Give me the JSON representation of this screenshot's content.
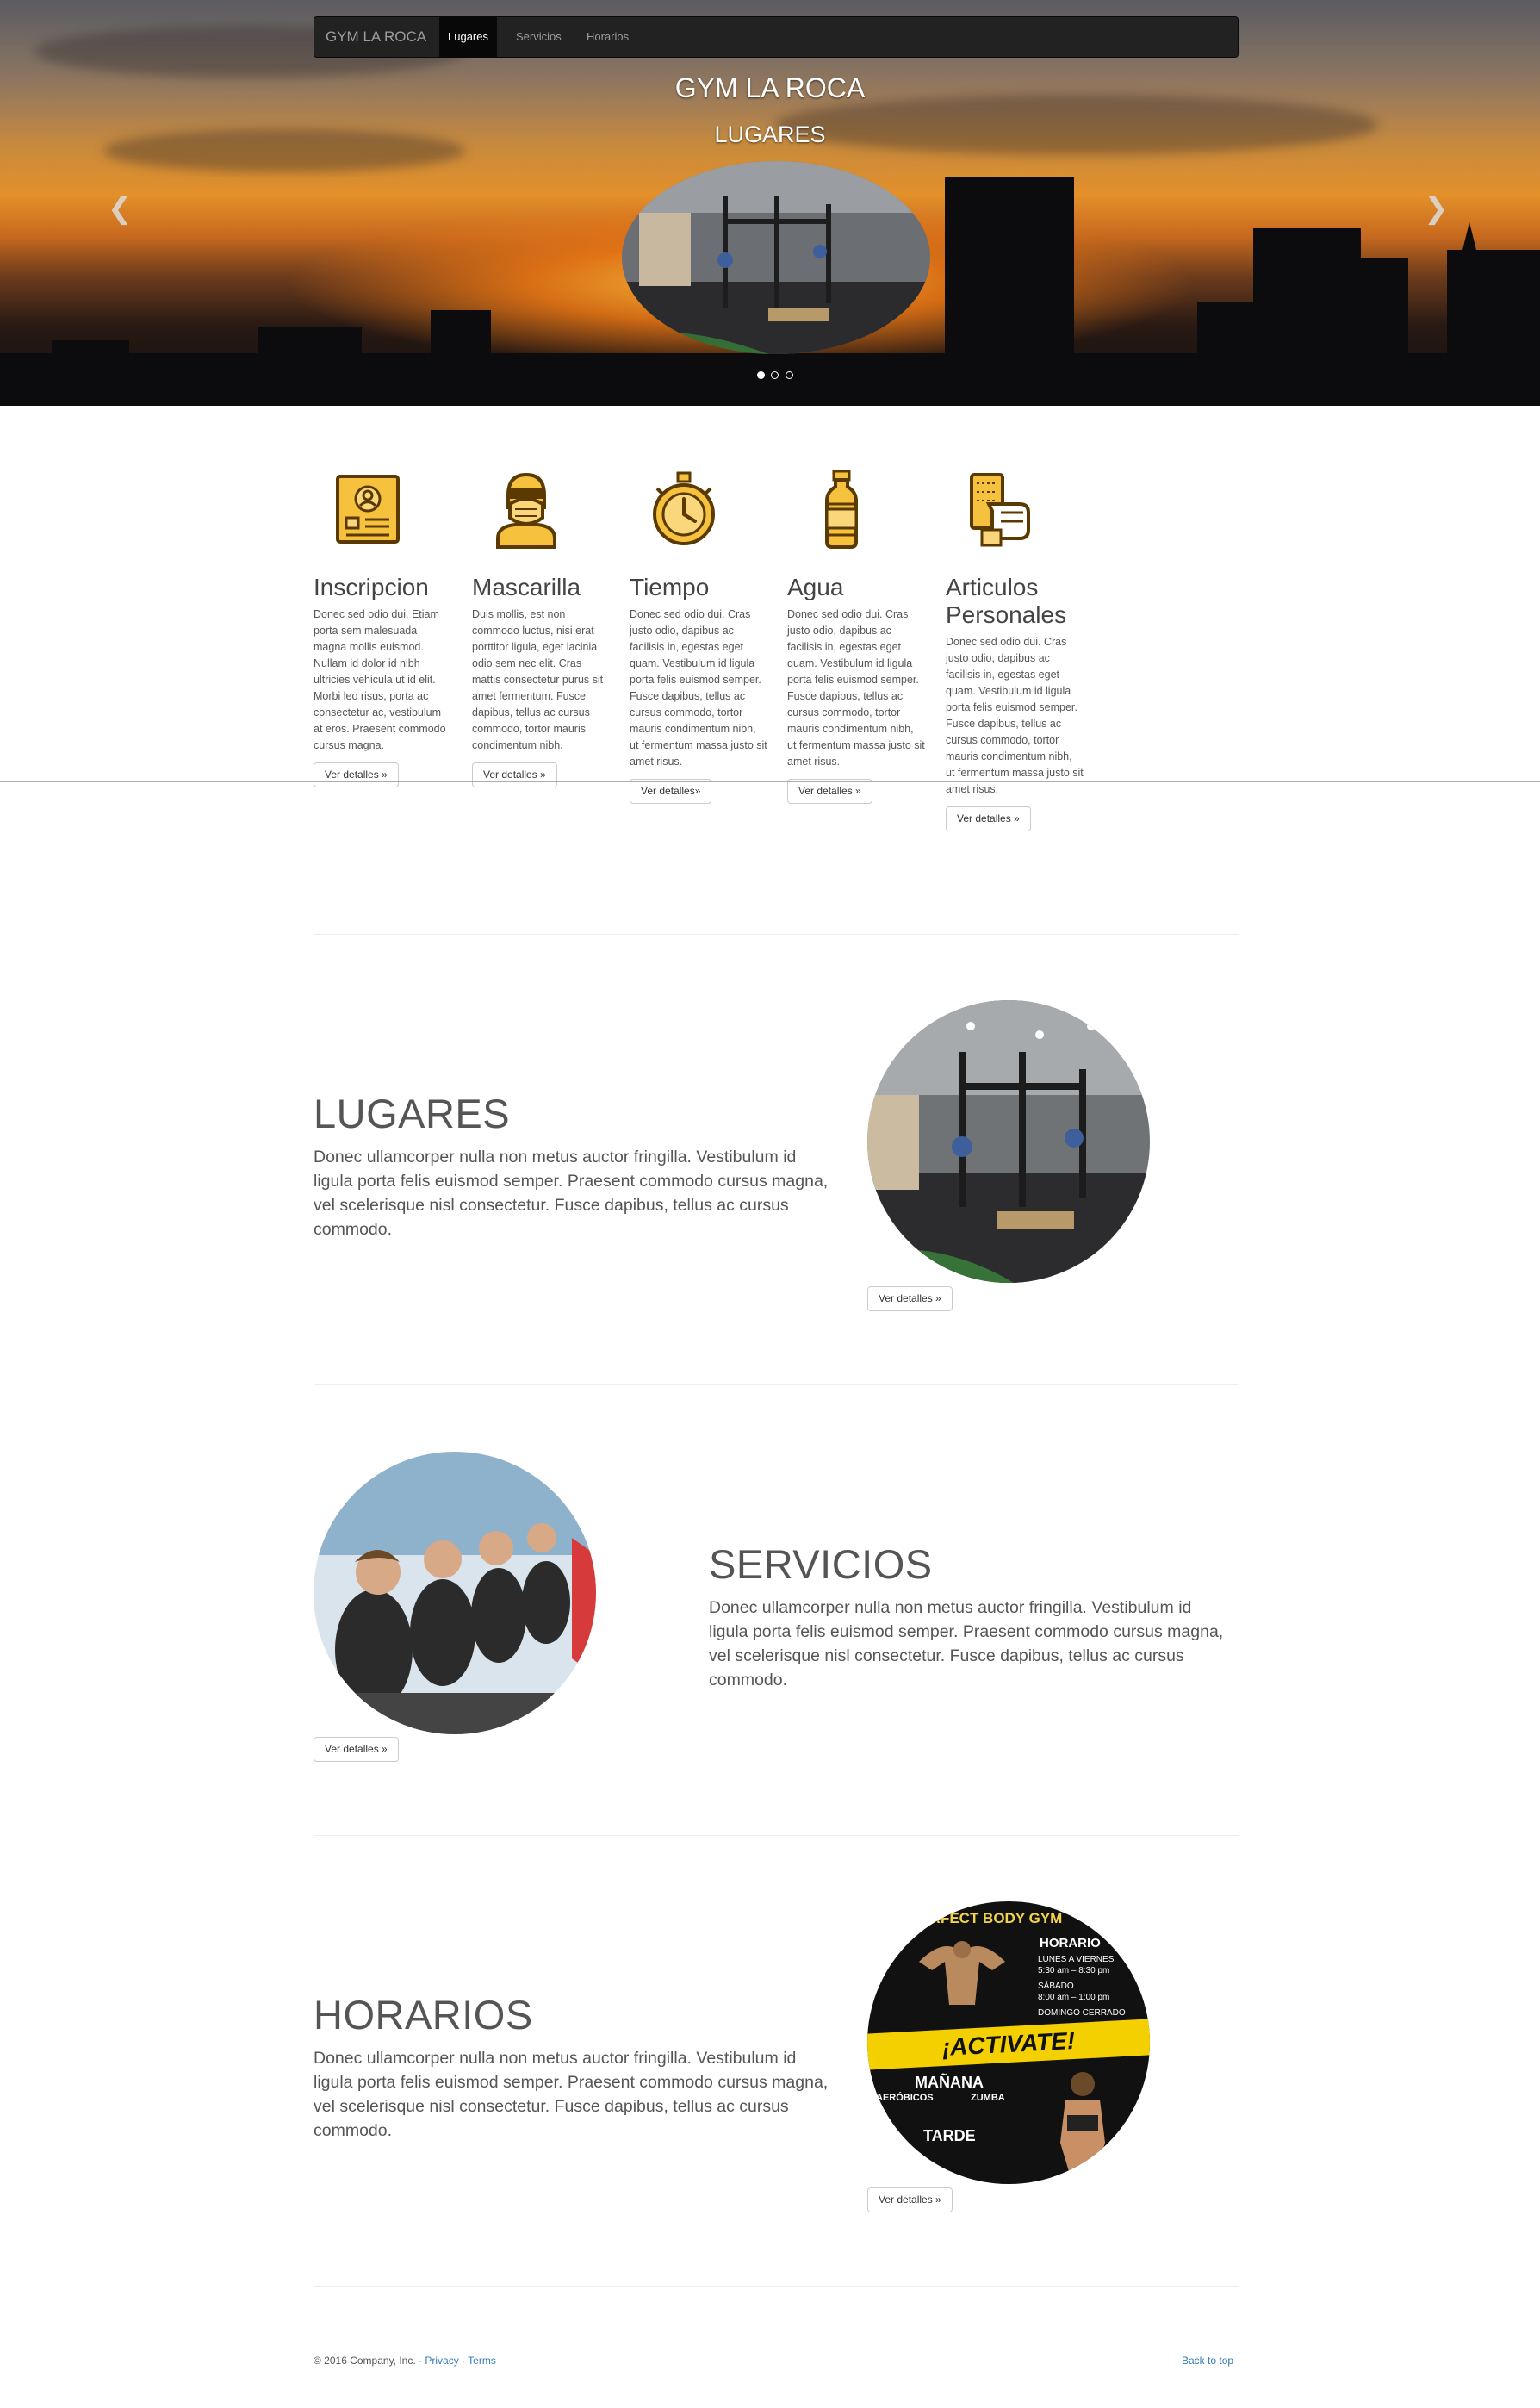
{
  "nav": {
    "brand": "GYM LA ROCA",
    "items": [
      {
        "label": "Lugares",
        "active": true
      },
      {
        "label": "Servicios",
        "active": false
      },
      {
        "label": "Horarios",
        "active": false
      }
    ]
  },
  "hero": {
    "title": "GYM LA ROCA",
    "subtitle": "LUGARES",
    "prev_icon": "chevron-left-icon",
    "next_icon": "chevron-right-icon",
    "slides_count": 3,
    "active_slide": 1
  },
  "features": [
    {
      "title": "Inscripcion",
      "icon": "id-card-icon",
      "text": "Donec sed odio dui. Etiam porta sem malesuada magna mollis euismod. Nullam id dolor id nibh ultricies vehicula ut id elit. Morbi leo risus, porta ac consectetur ac, vestibulum at eros. Praesent commodo cursus magna.",
      "button": "Ver detalles »"
    },
    {
      "title": "Mascarilla",
      "icon": "face-mask-icon",
      "text": "Duis mollis, est non commodo luctus, nisi erat porttitor ligula, eget lacinia odio sem nec elit. Cras mattis consectetur purus sit amet fermentum. Fusce dapibus, tellus ac cursus commodo, tortor mauris condimentum nibh.",
      "button": "Ver detalles »"
    },
    {
      "title": "Tiempo",
      "icon": "stopwatch-icon",
      "text": "Donec sed odio dui. Cras justo odio, dapibus ac facilisis in, egestas eget quam. Vestibulum id ligula porta felis euismod semper. Fusce dapibus, tellus ac cursus commodo, tortor mauris condimentum nibh, ut fermentum massa justo sit amet risus.",
      "button": "Ver detalles»"
    },
    {
      "title": "Agua",
      "icon": "water-bottle-icon",
      "text": "Donec sed odio dui. Cras justo odio, dapibus ac facilisis in, egestas eget quam. Vestibulum id ligula porta felis euismod semper. Fusce dapibus, tellus ac cursus commodo, tortor mauris condimentum nibh, ut fermentum massa justo sit amet risus.",
      "button": "Ver detalles »"
    },
    {
      "title": "Articulos Personales",
      "icon": "towel-hand-icon",
      "text": "Donec sed odio dui. Cras justo odio, dapibus ac facilisis in, egestas eget quam. Vestibulum id ligula porta felis euismod semper. Fusce dapibus, tellus ac cursus commodo, tortor mauris condimentum nibh, ut fermentum massa justo sit amet risus.",
      "button": "Ver detalles »"
    }
  ],
  "featurettes": [
    {
      "heading": "LUGARES",
      "text": "Donec ullamcorper nulla non metus auctor fringilla. Vestibulum id ligula porta felis euismod semper. Praesent commodo cursus magna, vel scelerisque nisl consectetur. Fusce dapibus, tellus ac cursus commodo.",
      "button": "Ver detalles »"
    },
    {
      "heading": "SERVICIOS",
      "text": "Donec ullamcorper nulla non metus auctor fringilla. Vestibulum id ligula porta felis euismod semper. Praesent commodo cursus magna, vel scelerisque nisl consectetur. Fusce dapibus, tellus ac cursus commodo.",
      "button": "Ver detalles »"
    },
    {
      "heading": "HORARIOS",
      "text": "Donec ullamcorper nulla non metus auctor fringilla. Vestibulum id ligula porta felis euismod semper. Praesent commodo cursus magna, vel scelerisque nisl consectetur. Fusce dapibus, tellus ac cursus commodo.",
      "button": "Ver detalles »"
    }
  ],
  "poster": {
    "top_text": "PERFECT BODY GYM",
    "horario": "HORARIO",
    "weekdays": "LUNES A VIERNES",
    "weekday_hours": "5:30 am – 8:30 pm",
    "saturday": "SÁBADO",
    "saturday_hours": "8:00 am – 1:00 pm",
    "sunday": "DOMINGO CERRADO",
    "banner": "¡ACTIVATE!",
    "morning": "MAÑANA",
    "afternoon": "TARDE",
    "aerobics": "AERÓBICOS",
    "zumba": "ZUMBA"
  },
  "footer": {
    "copyright": "© 2016 Company, Inc. ·",
    "privacy": "Privacy",
    "sep": "·",
    "terms": "Terms",
    "back_to_top": "Back to top"
  },
  "colors": {
    "navbar": "#222222",
    "icon_yellow": "#F6C23E",
    "icon_outline": "#5A3A00",
    "link": "#337ab7"
  }
}
